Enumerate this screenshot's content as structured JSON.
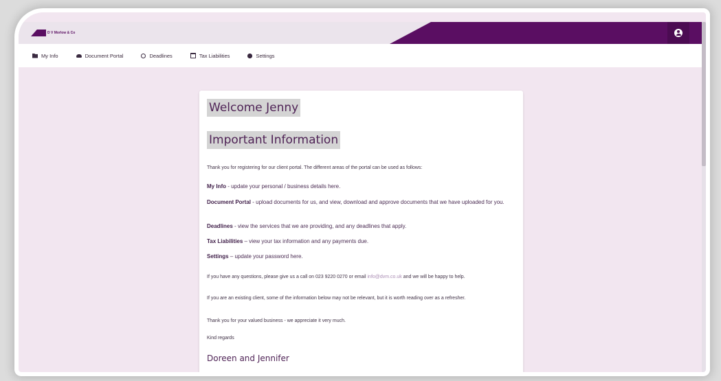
{
  "app": {
    "logo_text": "D V Morlow & Co"
  },
  "colors": {
    "brand": "#5a0e62",
    "page_bg": "#f2e6f0",
    "highlight": "#d4d4d4"
  },
  "nav": {
    "items": [
      {
        "label": "My Info",
        "icon": "folder-icon"
      },
      {
        "label": "Document Portal",
        "icon": "cloud-upload-icon"
      },
      {
        "label": "Deadlines",
        "icon": "clock-icon"
      },
      {
        "label": "Tax Liabilities",
        "icon": "calendar-icon"
      },
      {
        "label": "Settings",
        "icon": "gear-icon"
      }
    ]
  },
  "content": {
    "welcome": "Welcome Jenny",
    "important_heading": "Important Information",
    "intro": "Thank you for registering for our client portal. The different areas of the portal can be used as follows:",
    "sections": [
      {
        "title": "My Info",
        "text": " - update your personal / business details here."
      },
      {
        "title": "Document Portal",
        "text": " - upload documents for us, and view, download and approve documents that we have uploaded for you."
      },
      {
        "title": "Deadlines",
        "text": " - view the services that we are providing, and any deadlines that apply."
      },
      {
        "title": "Tax Liabilities",
        "text": " – view your tax information and any payments due."
      },
      {
        "title": "Settings",
        "text": " – update your password here."
      }
    ],
    "questions_pre": "If you have any questions, please give us a call on 023 9220 0270 or email ",
    "email": "info@dvm.co.uk",
    "questions_post": " and we will be happy to help.",
    "existing": "If you are an existing client, some of the information below may not be relevant, but it is worth reading over as a refresher.",
    "thanks": "Thank you for your valued business - we appreciate it very much.",
    "regards": "Kind regards",
    "signature": "Doreen and Jennifer"
  }
}
